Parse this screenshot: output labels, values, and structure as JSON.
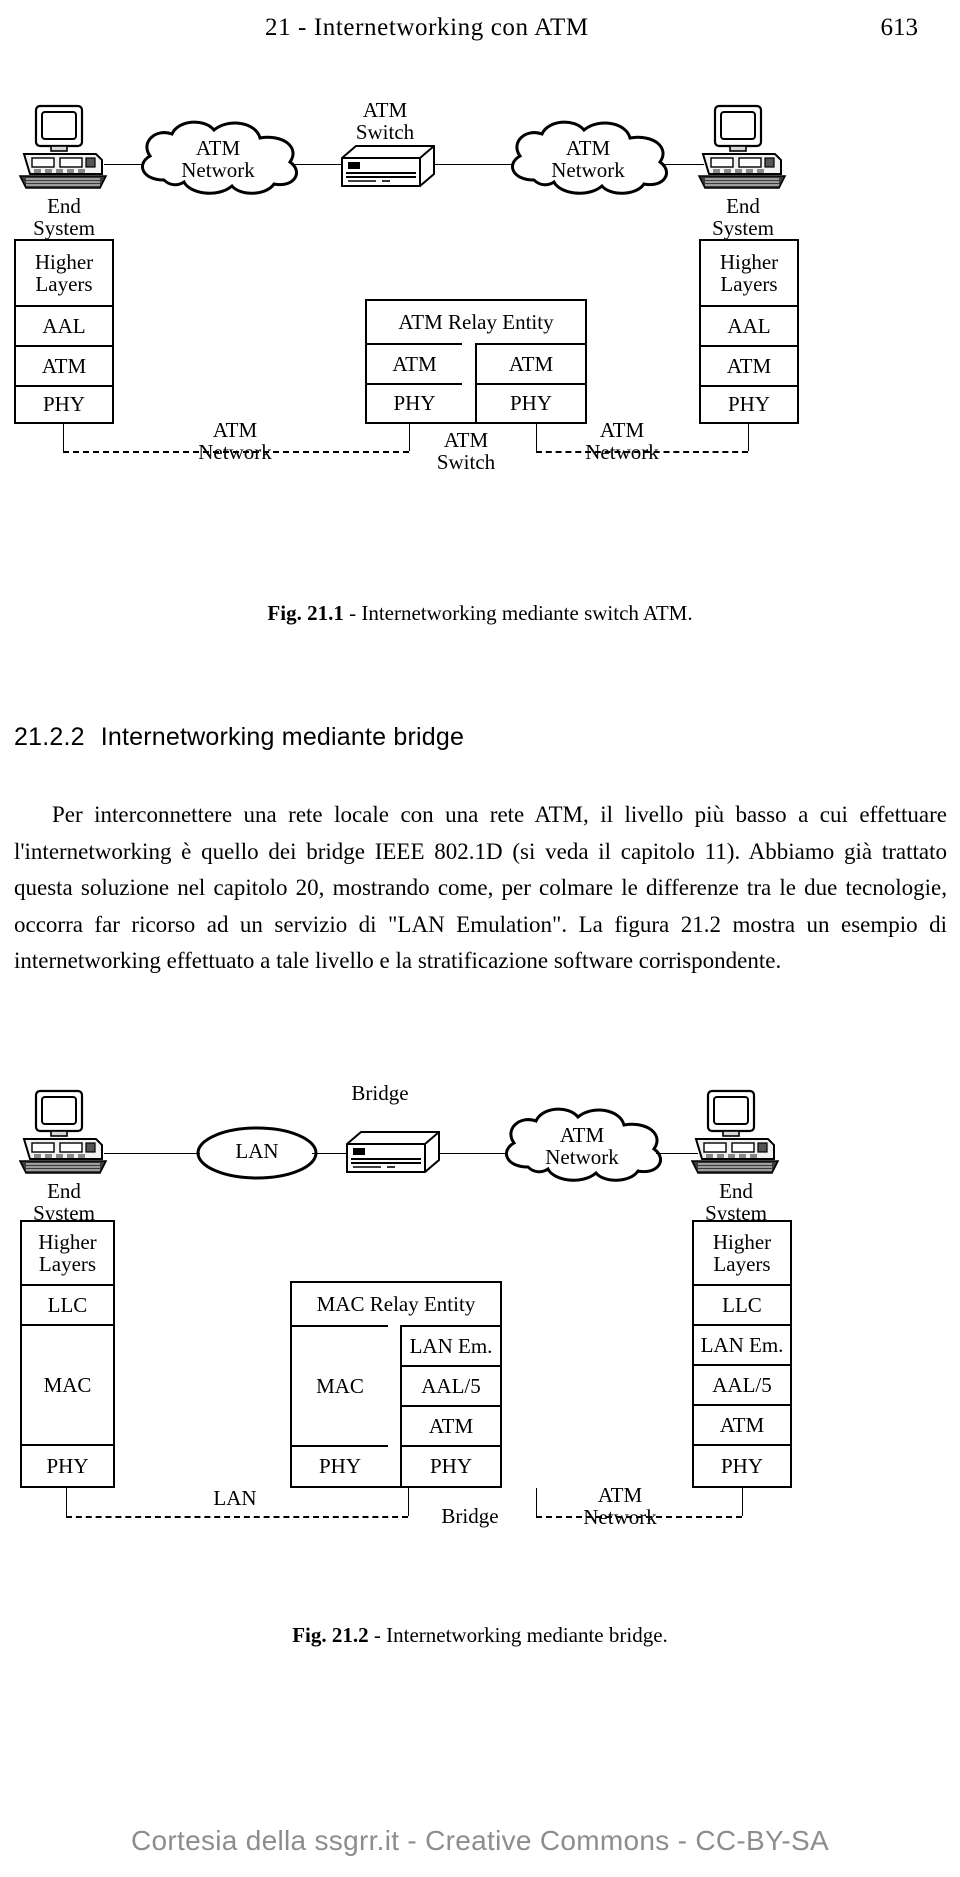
{
  "header": {
    "chapter_title": "21 - Internetworking con ATM",
    "page_number": "613"
  },
  "figure1": {
    "topology": {
      "left_device_label": "End\nSystem",
      "left_cloud_label": "ATM\nNetwork",
      "switch_label": "ATM\nSwitch",
      "right_cloud_label": "ATM\nNetwork",
      "right_device_label": "End\nSystem"
    },
    "left_stack": [
      "Higher\nLayers",
      "AAL",
      "ATM",
      "PHY"
    ],
    "middle_header": "ATM Relay Entity",
    "middle_left_stack": [
      "ATM",
      "PHY"
    ],
    "middle_right_stack": [
      "ATM",
      "PHY"
    ],
    "right_stack": [
      "Higher\nLayers",
      "AAL",
      "ATM",
      "PHY"
    ],
    "link_labels": {
      "left": "ATM\nNetwork",
      "center": "ATM\nSwitch",
      "right": "ATM\nNetwork"
    },
    "caption_label": "Fig. 21.1",
    "caption_dash": "-",
    "caption_text": "Internetworking mediante switch ATM."
  },
  "section": {
    "number": "21.2.2",
    "title": "Internetworking mediante bridge"
  },
  "paragraph": "Per interconnettere una rete locale con una rete ATM, il livello più basso a cui effettuare l'internetworking è quello dei bridge IEEE 802.1D (si veda il capitolo 11). Abbiamo già trattato questa soluzione nel capitolo 20, mostrando come, per colmare le differenze tra le due tecnologie, occorra far ricorso ad un servizio di \"LAN Emulation\". La figura 21.2 mostra un esempio di internetworking effettuato a tale livello e la stratificazione software corrispondente.",
  "figure2": {
    "topology": {
      "left_device_label": "End\nSystem",
      "lan_label": "LAN",
      "bridge_label": "Bridge",
      "cloud_label": "ATM\nNetwork",
      "right_device_label": "End\nSystem"
    },
    "left_stack": [
      "Higher\nLayers",
      "LLC",
      "MAC",
      "PHY"
    ],
    "middle_header": "MAC Relay Entity",
    "middle_left_stack": [
      "MAC",
      "PHY"
    ],
    "middle_right_stack": [
      "LAN Em.",
      "AAL/5",
      "ATM",
      "PHY"
    ],
    "right_stack": [
      "Higher\nLayers",
      "LLC",
      "LAN Em.",
      "AAL/5",
      "ATM",
      "PHY"
    ],
    "link_labels": {
      "left": "LAN",
      "center": "Bridge",
      "right": "ATM\nNetwork"
    },
    "caption_label": "Fig. 21.2",
    "caption_dash": "-",
    "caption_text": "Internetworking mediante bridge."
  },
  "footer": {
    "credit": "Cortesia della ssgrr.it - Creative Commons - CC-BY-SA"
  },
  "colors": {
    "ink": "#000000",
    "paper": "#ffffff",
    "watermark": "#8d8d8d"
  }
}
